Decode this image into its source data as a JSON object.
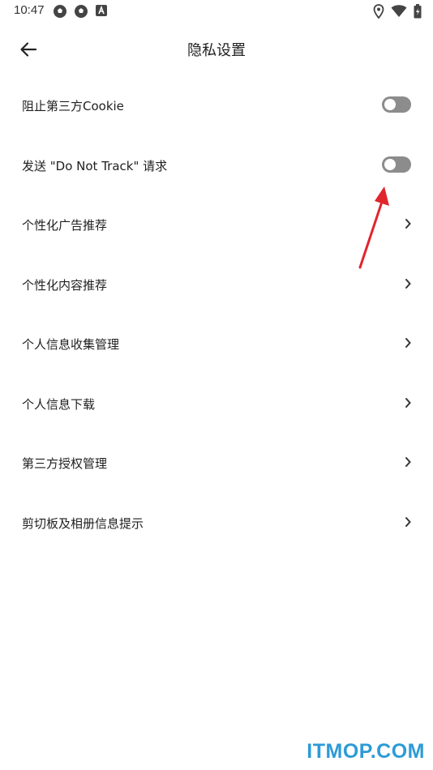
{
  "status_bar": {
    "time": "10:47",
    "left_icons": [
      "soccer-icon",
      "soccer-icon",
      "font-icon"
    ],
    "right_icons": [
      "location-icon",
      "wifi-icon",
      "battery-icon"
    ]
  },
  "header": {
    "back_icon": "arrow-left-icon",
    "title": "隐私设置"
  },
  "settings": [
    {
      "label": "阻止第三方Cookie",
      "control": "toggle",
      "enabled": false
    },
    {
      "label": "发送 \"Do Not Track\" 请求",
      "control": "toggle",
      "enabled": false
    },
    {
      "label": "个性化广告推荐",
      "control": "chevron"
    },
    {
      "label": "个性化内容推荐",
      "control": "chevron"
    },
    {
      "label": "个人信息收集管理",
      "control": "chevron"
    },
    {
      "label": "个人信息下载",
      "control": "chevron"
    },
    {
      "label": "第三方授权管理",
      "control": "chevron"
    },
    {
      "label": "剪切板及相册信息提示",
      "control": "chevron"
    }
  ],
  "colors": {
    "toggle_off": "#8c8c8c",
    "annotation_arrow": "#e0262c",
    "watermark": "#2d9bd6"
  },
  "watermark": "ITMOP.COM"
}
